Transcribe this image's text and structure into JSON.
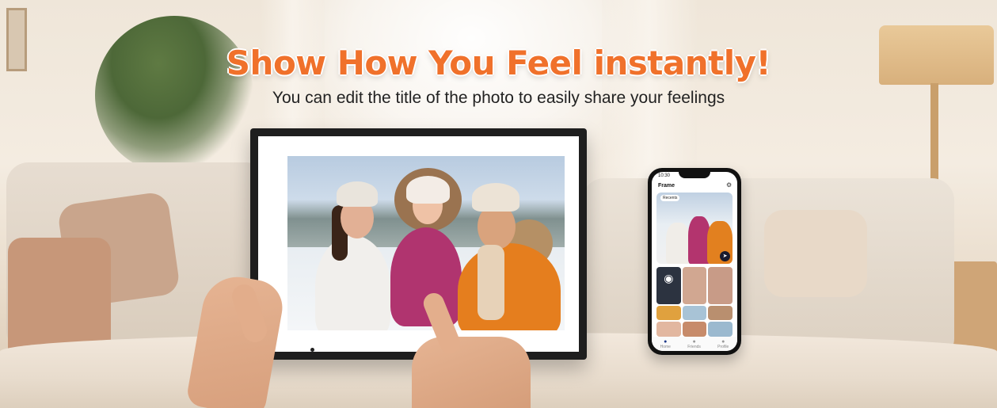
{
  "banner": {
    "headline": "Show How You Feel instantly!",
    "subline": "You can edit the title of the photo to easily share your feelings"
  },
  "frame_device": {
    "screen_icon": "photo-icon",
    "indicator_icon": "power-dot-icon"
  },
  "phone": {
    "status_time": "10:30",
    "app_title": "Frame",
    "settings_icon": "gear-icon",
    "album_filter": "Recents",
    "send_icon": "send-icon",
    "camera_icon": "camera-icon",
    "tabs": [
      {
        "label": "Home",
        "icon": "home-icon"
      },
      {
        "label": "Friends",
        "icon": "friends-icon"
      },
      {
        "label": "Profile",
        "icon": "profile-icon"
      }
    ]
  },
  "colors": {
    "headline": "#f0712b",
    "subline": "#222222",
    "frame": "#1e1e1e"
  }
}
